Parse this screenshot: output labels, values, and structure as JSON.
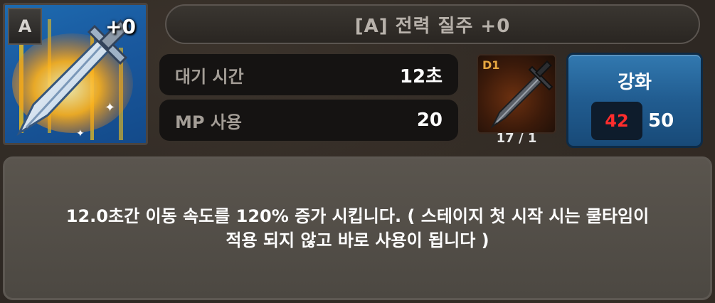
{
  "skill": {
    "grade": "A",
    "level": "+0",
    "title": "[A] 전력 질주 +0",
    "icon": "flaming-sword-icon"
  },
  "stats": {
    "cooldown_label": "대기 시간",
    "cooldown_value": "12초",
    "mp_label": "MP 사용",
    "mp_value": "20"
  },
  "material": {
    "tier": "D1",
    "count": "17 / 1",
    "icon": "dark-sword-icon"
  },
  "enhance": {
    "label": "강화",
    "have": "42",
    "need": "50",
    "have_color": "#ff2d2d",
    "button_color": "#2a6aa3"
  },
  "description": "12.0초간 이동 속도를 120% 증가 시킵니다. ( 스테이지 첫 시작 시는 쿨타임이\n적용 되지 않고 바로 사용이 됩니다 )"
}
